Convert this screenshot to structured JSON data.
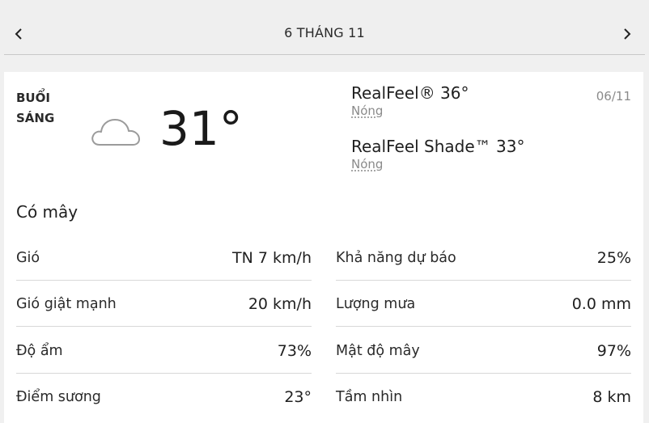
{
  "header": {
    "date_title": "6 THÁNG 11"
  },
  "period": {
    "line1": "BUỔI",
    "line2": "SÁNG"
  },
  "current": {
    "icon": "cloud-icon",
    "temperature": "31°",
    "date": "06/11",
    "condition": "Có mây"
  },
  "realfeel": {
    "title": "RealFeel® 36°",
    "desc": "Nóng"
  },
  "realfeel_shade": {
    "title": "RealFeel Shade™ 33°",
    "desc": "Nóng"
  },
  "details_left": [
    {
      "label": "Gió",
      "value": "TN 7 km/h"
    },
    {
      "label": "Gió giật mạnh",
      "value": "20 km/h"
    },
    {
      "label": "Độ ẩm",
      "value": "73%"
    },
    {
      "label": "Điểm sương",
      "value": "23°"
    }
  ],
  "details_right": [
    {
      "label": "Khả năng dự báo",
      "value": "25%"
    },
    {
      "label": "Lượng mưa",
      "value": "0.0 mm"
    },
    {
      "label": "Mật độ mây",
      "value": "97%"
    },
    {
      "label": "Tầm nhìn",
      "value": "8 km"
    }
  ]
}
